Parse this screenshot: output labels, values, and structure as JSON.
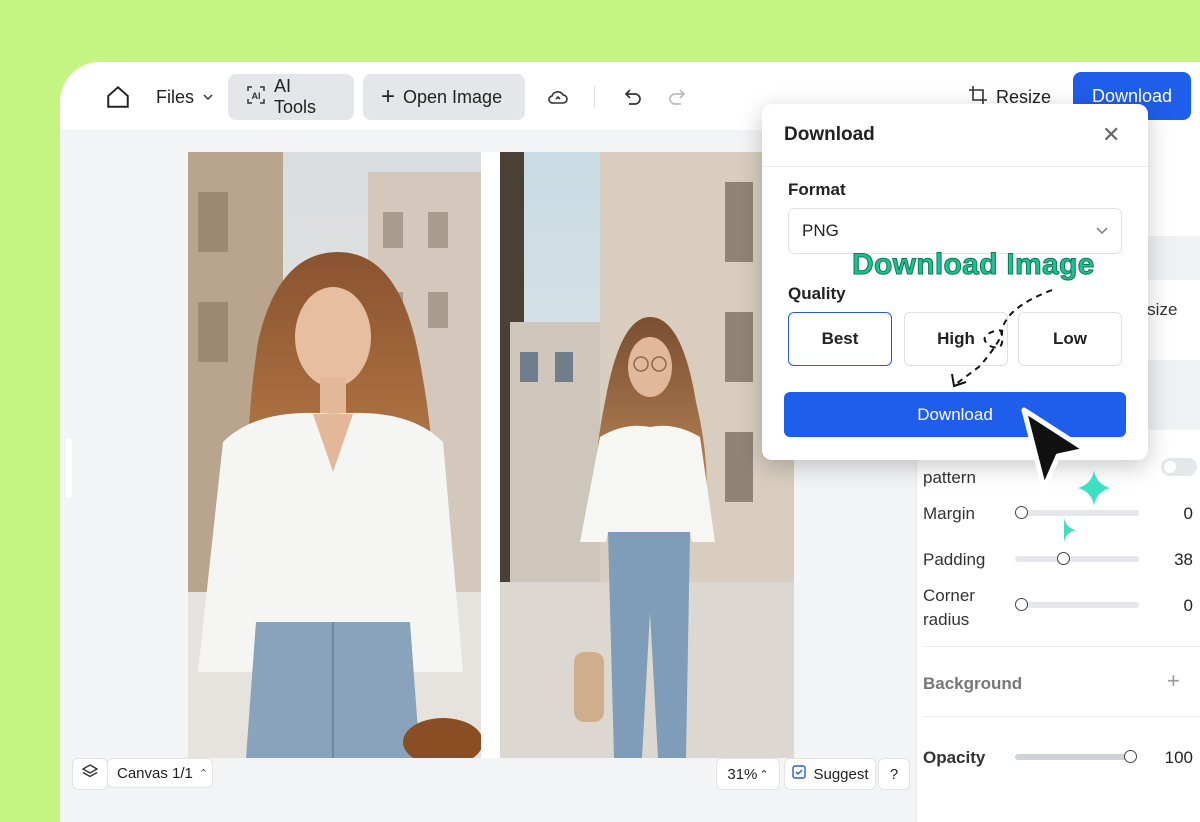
{
  "toolbar": {
    "files_label": "Files",
    "ai_tools_label": "AI Tools",
    "open_image_label": "Open Image",
    "resize_label": "Resize",
    "download_label": "Download"
  },
  "panel": {
    "partial_size_label": "d size",
    "seamless_label": "pattern",
    "margin_label": "Margin",
    "margin_value": 0,
    "padding_label": "Padding",
    "padding_value": 38,
    "corner_label_1": "Corner",
    "corner_label_2": "radius",
    "corner_value": 0,
    "background_label": "Background",
    "opacity_label": "Opacity",
    "opacity_value": 100
  },
  "bottom": {
    "canvas_label": "Canvas 1/1",
    "zoom_label": "31%",
    "suggest_label": "Suggest",
    "help_label": "?"
  },
  "modal": {
    "title": "Download",
    "format_label": "Format",
    "format_value": "PNG",
    "quality_label": "Quality",
    "quality_options": [
      "Best",
      "High",
      "Low"
    ],
    "quality_selected": "Best",
    "download_button": "Download"
  },
  "annotation": {
    "text": "Download Image"
  },
  "colors": {
    "background": "#c4f582",
    "accent": "#1f5eea",
    "annotation": "#1fbf8f"
  }
}
